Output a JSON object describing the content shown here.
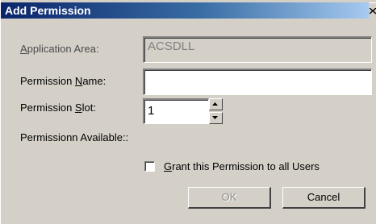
{
  "dialog": {
    "title": "Add Permission"
  },
  "fields": {
    "application_area": {
      "label_prefix": "",
      "label_mnemonic": "A",
      "label_suffix": "pplication Area:",
      "value": "ACSDLL",
      "enabled": false
    },
    "permission_name": {
      "label_prefix": "Permission ",
      "label_mnemonic": "N",
      "label_suffix": "ame:",
      "value": ""
    },
    "permission_slot": {
      "label_prefix": "Permission ",
      "label_mnemonic": "S",
      "label_suffix": "lot:",
      "value": "1"
    },
    "permission_available": {
      "label": "Permissionn Available::"
    }
  },
  "grant_all": {
    "label_mnemonic": "G",
    "label_suffix": "rant this Permission to all Users",
    "checked": false
  },
  "buttons": {
    "ok": {
      "label": "OK",
      "enabled": false
    },
    "cancel": {
      "label": "Cancel",
      "enabled": true
    }
  },
  "colors": {
    "dialog_face": "#d4d0c8",
    "titlebar_start": "#0a246a",
    "titlebar_end": "#a6caf0",
    "title_text": "#ffffff",
    "disabled_text": "#808080"
  }
}
